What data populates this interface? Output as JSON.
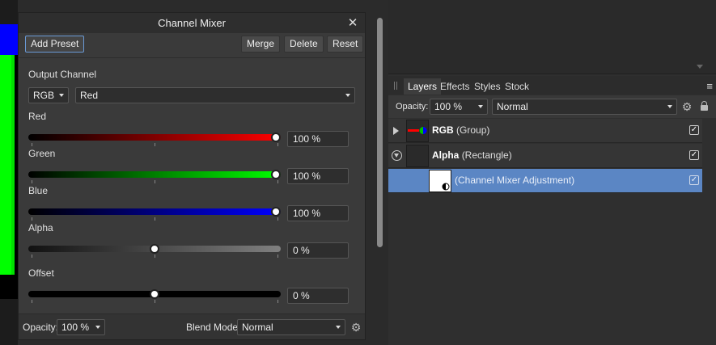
{
  "dialog": {
    "title": "Channel Mixer",
    "close_glyph": "✕",
    "add_preset": "Add Preset",
    "merge": "Merge",
    "delete": "Delete",
    "reset": "Reset",
    "output_channel_label": "Output Channel",
    "color_model": "RGB",
    "channel": "Red",
    "sliders": [
      {
        "label": "Red",
        "value_text": "100 %",
        "value": 1.0
      },
      {
        "label": "Green",
        "value_text": "100 %",
        "value": 1.0
      },
      {
        "label": "Blue",
        "value_text": "100 %",
        "value": 1.0
      },
      {
        "label": "Alpha",
        "value_text": "0 %",
        "value": 0.0
      },
      {
        "label": "Offset",
        "value_text": "0 %",
        "value": 0.0
      }
    ],
    "colors": {
      "red": "#ff0000",
      "green": "#00ff00",
      "blue": "#0000ff",
      "alpha": "#808080",
      "offset": "#000000"
    },
    "footer": {
      "opacity_label": "Opacity:",
      "opacity_value": "100 %",
      "blend_label": "Blend Mode:",
      "blend_value": "Normal"
    }
  },
  "layers_panel": {
    "tabs": [
      "Layers",
      "Effects",
      "Styles",
      "Stock"
    ],
    "active_tab": "Layers",
    "opacity_label": "Opacity:",
    "opacity_value": "100 %",
    "blend_value": "Normal",
    "menu_glyph": "≡",
    "rows": [
      {
        "name": "RGB",
        "type": "(Group)",
        "checked": "✓"
      },
      {
        "name": "Alpha",
        "type": "(Rectangle)",
        "checked": "✓"
      },
      {
        "name": "",
        "type": "(Channel Mixer Adjustment)",
        "checked": "✓"
      }
    ],
    "accent": "#5b86c4"
  }
}
